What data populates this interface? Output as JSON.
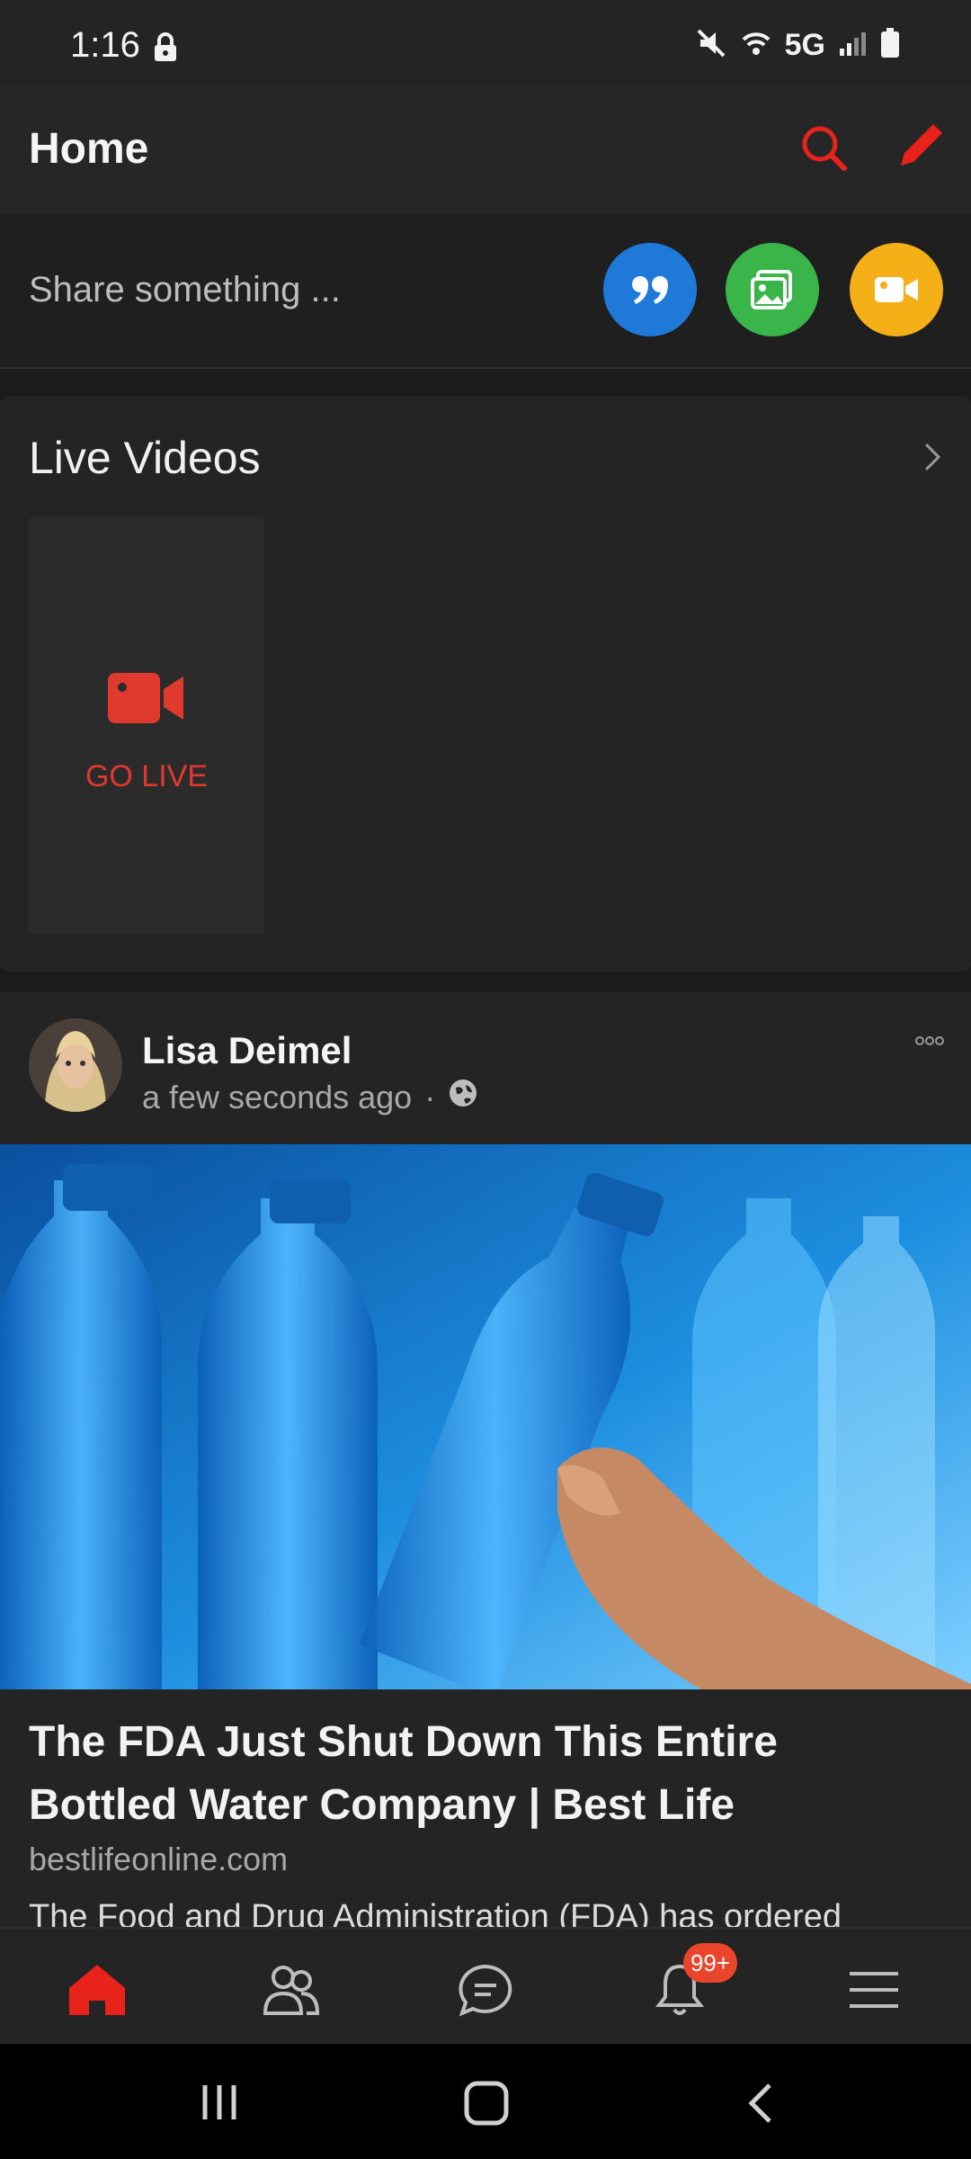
{
  "status_bar": {
    "time": "1:16",
    "network": "5G",
    "icons": [
      "lock-icon",
      "mute-icon",
      "wifi-icon",
      "signal-icon",
      "battery-icon"
    ]
  },
  "header": {
    "title": "Home",
    "icons": [
      "search-icon",
      "pencil-icon"
    ],
    "accent_color": "#e8231b"
  },
  "composer": {
    "placeholder": "Share something ...",
    "buttons": [
      {
        "icon": "quote-icon",
        "color": "#1e79d9"
      },
      {
        "icon": "photo-icon",
        "color": "#39b54a"
      },
      {
        "icon": "video-camera-icon",
        "color": "#f5b018"
      }
    ]
  },
  "live_videos": {
    "title": "Live Videos",
    "go_live_label": "GO LIVE",
    "go_live_color": "#e03a2f"
  },
  "post": {
    "author": "Lisa Deimel",
    "time": "a few seconds ago",
    "separator": "·",
    "privacy_icon": "globe-icon",
    "link": {
      "title": "The FDA Just Shut Down This Entire Bottled Water Company | Best Life",
      "domain": "bestlifeonline.com",
      "description": "The Food and Drug Administration (FDA) has ordered"
    }
  },
  "bottom_nav": {
    "items": [
      "home-icon",
      "friends-icon",
      "messages-icon",
      "notifications-icon",
      "menu-icon"
    ],
    "active": "home-icon",
    "notification_badge": "99+"
  },
  "system_nav": {
    "items": [
      "recent-apps-icon",
      "home-button-icon",
      "back-icon"
    ]
  }
}
